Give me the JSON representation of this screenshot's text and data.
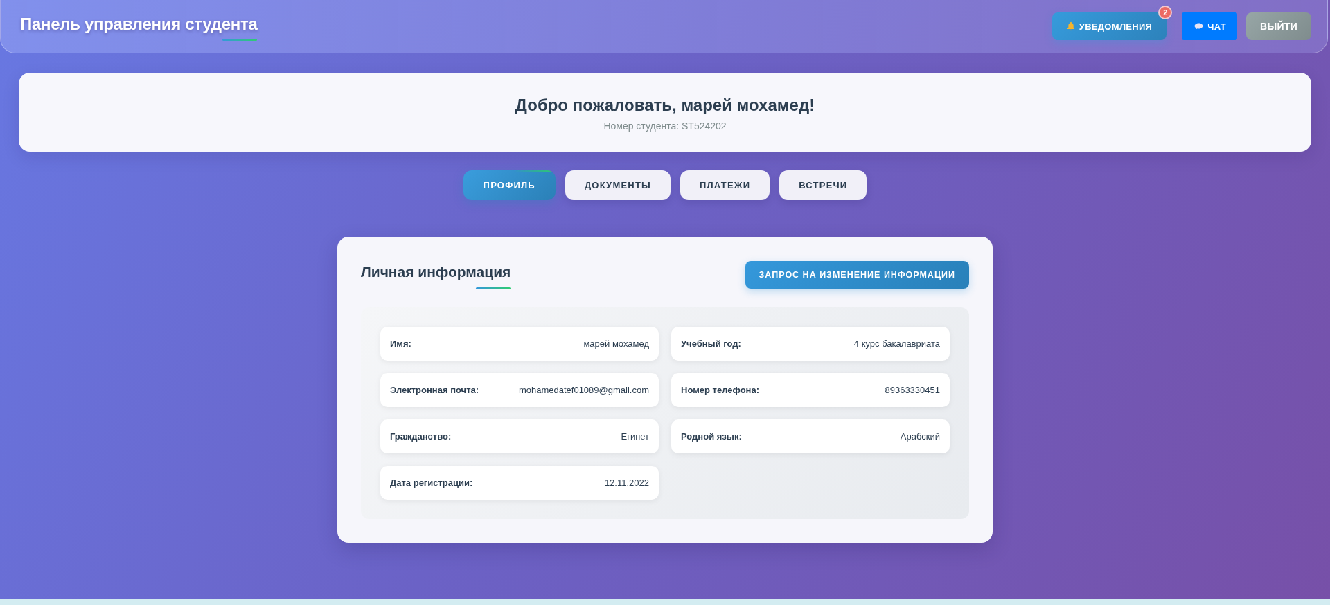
{
  "header": {
    "title": "Панель управления студента",
    "buttons": [
      {
        "kind": "notifications",
        "label": "УВЕДОМЛЕНИЯ",
        "badge": "2"
      },
      {
        "kind": "chat",
        "label": "ЧАТ"
      },
      {
        "kind": "logout",
        "label": "ВЫЙТИ"
      }
    ]
  },
  "welcome": {
    "title": "Добро пожаловать, марей мохамед!",
    "subtitle": "Номер студента: ST524202"
  },
  "tabs": [
    {
      "label": "ПРОФИЛЬ",
      "selected": true
    },
    {
      "label": "ДОКУМЕНТЫ",
      "selected": false
    },
    {
      "label": "ПЛАТЕЖИ",
      "selected": false
    },
    {
      "label": "ВСТРЕЧИ",
      "selected": false
    }
  ],
  "profile": {
    "title": "Личная информация",
    "button": "ЗАПРОС НА ИЗМЕНЕНИЕ ИНФОРМАЦИИ",
    "fields": [
      {
        "label": "Имя:",
        "value": "марей мохамед"
      },
      {
        "label": "Учебный год:",
        "value": "4 курс бакалавриата"
      },
      {
        "label": "Электронная почта:",
        "value": "mohamedatef01089@gmail.com"
      },
      {
        "label": "Номер телефона:",
        "value": "89363330451"
      },
      {
        "label": "Гражданство:",
        "value": "Египет"
      },
      {
        "label": "Родной язык:",
        "value": "Арабский"
      },
      {
        "label": "Дата регистрации:",
        "value": "12.11.2022"
      }
    ]
  }
}
